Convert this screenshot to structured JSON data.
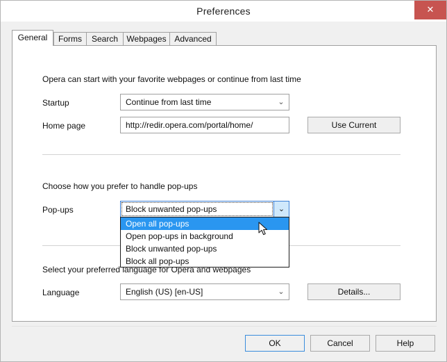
{
  "window": {
    "title": "Preferences",
    "close_icon": "close-icon",
    "close_glyph": "✕",
    "close_color": "#c75450"
  },
  "tabs": [
    {
      "label": "General",
      "active": true
    },
    {
      "label": "Forms",
      "active": false
    },
    {
      "label": "Search",
      "active": false
    },
    {
      "label": "Webpages",
      "active": false
    },
    {
      "label": "Advanced",
      "active": false
    }
  ],
  "startup_section": {
    "description": "Opera can start with your favorite webpages or continue from last time",
    "startup_label": "Startup",
    "startup_value": "Continue from last time",
    "homepage_label": "Home page",
    "homepage_value": "http://redir.opera.com/portal/home/",
    "use_current_label": "Use Current"
  },
  "popups_section": {
    "description": "Choose how you prefer to handle pop-ups",
    "popups_label": "Pop-ups",
    "popups_value": "Block unwanted pop-ups",
    "options": [
      "Open all pop-ups",
      "Open pop-ups in background",
      "Block unwanted pop-ups",
      "Block all pop-ups"
    ],
    "highlighted_option": "Open all pop-ups",
    "highlight_color": "#2a96f0"
  },
  "language_section": {
    "description": "Select your preferred language for Opera and webpages",
    "language_label": "Language",
    "language_value": "English (US) [en-US]",
    "details_label": "Details..."
  },
  "footer": {
    "ok_label": "OK",
    "cancel_label": "Cancel",
    "help_label": "Help",
    "default_button_accent": "#3a8ddc"
  },
  "icons": {
    "chevron_down": "⌄"
  }
}
